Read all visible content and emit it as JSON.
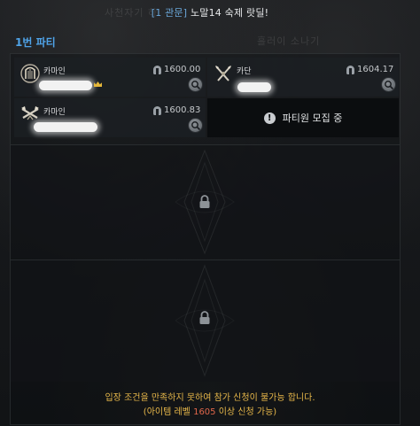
{
  "header": {
    "tag": "[1 관문]",
    "title": "노말14 숙제 랏딜!",
    "ghost_left": "사천자기 하",
    "ghost_right": "흘러이 소나기"
  },
  "party": {
    "label": "1번 파티",
    "members": [
      {
        "class": "카마인",
        "item_level": "1600.00",
        "icon": "bard-harp-icon",
        "leader": true
      },
      {
        "class": "카단",
        "item_level": "1604.17",
        "icon": "slayer-crossed-blades-icon",
        "leader": false
      },
      {
        "class": "카마인",
        "item_level": "1600.83",
        "icon": "gunslinger-crossed-guns-icon",
        "leader": false
      }
    ],
    "recruit_text": "파티원 모집 중",
    "locked_slot_icon": "lock-icon"
  },
  "footer": {
    "line1": "입장 조건을 만족하지 못하여 참가 신청이 불가능 합니다.",
    "line2_prefix": "(아이템 레벨",
    "line2_level": "1605",
    "line2_suffix": "이상 신청 가능)"
  },
  "colors": {
    "accent_blue": "#4fa3e8",
    "warning_gold": "#e8b84a",
    "requirement_red": "#e0664a"
  }
}
